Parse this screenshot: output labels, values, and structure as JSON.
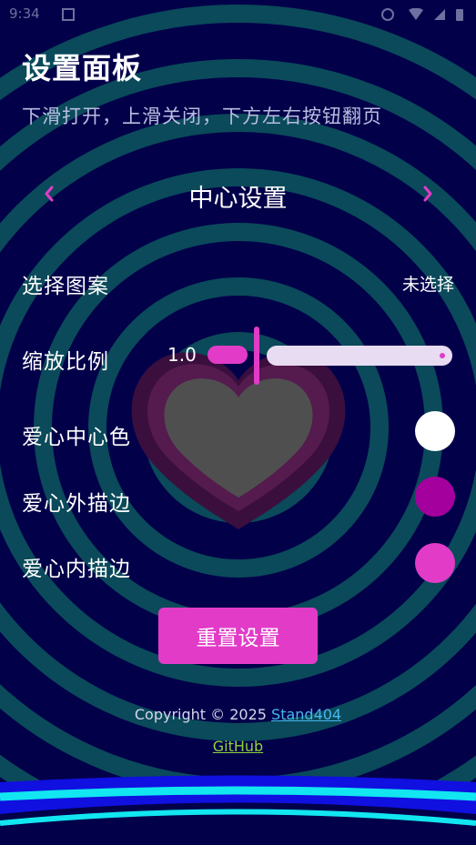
{
  "status_bar": {
    "time": "9:34"
  },
  "panel": {
    "title": "设置面板",
    "subtitle": "下滑打开，上滑关闭，下方左右按钮翻页"
  },
  "pager": {
    "title": "中心设置",
    "prev_icon": "chevron-left-icon",
    "next_icon": "chevron-right-icon"
  },
  "settings": {
    "pattern": {
      "label": "选择图案",
      "value": "未选择"
    },
    "scale": {
      "label": "缩放比例",
      "value": "1.0"
    },
    "center_color": {
      "label": "爱心中心色",
      "color": "#ffffff"
    },
    "outer_stroke": {
      "label": "爱心外描边",
      "color": "#a4009e"
    },
    "inner_stroke": {
      "label": "爱心内描边",
      "color": "#e23bc8"
    }
  },
  "reset_button": {
    "label": "重置设置"
  },
  "footer": {
    "copyright": "Copyright © 2025 ",
    "author_link": "Stand404",
    "github_link": "GitHub"
  },
  "colors": {
    "background": "#03004a",
    "ring": "#0a4a5a",
    "accent": "#e23bc8",
    "heart_outer": "#3a0f3e",
    "heart_mid": "#551a4e",
    "heart_center": "#4f4f4f"
  }
}
